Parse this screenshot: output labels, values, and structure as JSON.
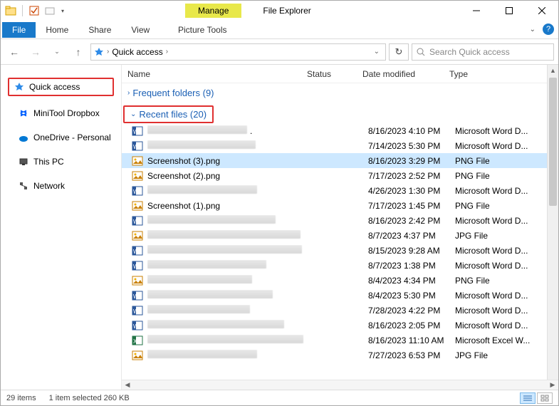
{
  "titlebar": {
    "manage_label": "Manage",
    "app_title": "File Explorer"
  },
  "ribbon": {
    "file": "File",
    "home": "Home",
    "share": "Share",
    "view": "View",
    "picture_tools": "Picture Tools"
  },
  "nav": {
    "crumb_root": "Quick access",
    "search_placeholder": "Search Quick access"
  },
  "sidebar": {
    "quick_access": "Quick access",
    "dropbox": "MiniTool Dropbox",
    "onedrive": "OneDrive - Personal",
    "this_pc": "This PC",
    "network": "Network"
  },
  "columns": {
    "name": "Name",
    "status": "Status",
    "date": "Date modified",
    "type": "Type"
  },
  "groups": {
    "frequent": {
      "label": "Frequent folders",
      "count": 9
    },
    "recent": {
      "label": "Recent files",
      "count": 20
    }
  },
  "files": [
    {
      "name": "",
      "blurred": true,
      "date": "8/16/2023 4:10 PM",
      "type": "Microsoft Word D...",
      "icon": "word",
      "selected": false,
      "dotafter": true
    },
    {
      "name": "",
      "blurred": true,
      "date": "7/14/2023 5:30 PM",
      "type": "Microsoft Word D...",
      "icon": "word",
      "selected": false
    },
    {
      "name": "Screenshot (3).png",
      "blurred": false,
      "date": "8/16/2023 3:29 PM",
      "type": "PNG File",
      "icon": "png",
      "selected": true
    },
    {
      "name": "Screenshot (2).png",
      "blurred": false,
      "date": "7/17/2023 2:52 PM",
      "type": "PNG File",
      "icon": "png",
      "selected": false
    },
    {
      "name": "",
      "blurred": true,
      "date": "4/26/2023 1:30 PM",
      "type": "Microsoft Word D...",
      "icon": "word",
      "selected": false
    },
    {
      "name": "Screenshot (1).png",
      "blurred": false,
      "date": "7/17/2023 1:45 PM",
      "type": "PNG File",
      "icon": "png",
      "selected": false
    },
    {
      "name": "",
      "blurred": true,
      "date": "8/16/2023 2:42 PM",
      "type": "Microsoft Word D...",
      "icon": "word",
      "selected": false
    },
    {
      "name": "",
      "blurred": true,
      "date": "8/7/2023 4:37 PM",
      "type": "JPG File",
      "icon": "jpg",
      "selected": false
    },
    {
      "name": "",
      "blurred": true,
      "date": "8/15/2023 9:28 AM",
      "type": "Microsoft Word D...",
      "icon": "word",
      "selected": false
    },
    {
      "name": "",
      "blurred": true,
      "date": "8/7/2023 1:38 PM",
      "type": "Microsoft Word D...",
      "icon": "word",
      "selected": false
    },
    {
      "name": "",
      "blurred": true,
      "date": "8/4/2023 4:34 PM",
      "type": "PNG File",
      "icon": "png",
      "selected": false
    },
    {
      "name": "",
      "blurred": true,
      "date": "8/4/2023 5:30 PM",
      "type": "Microsoft Word D...",
      "icon": "word",
      "selected": false
    },
    {
      "name": "",
      "blurred": true,
      "date": "7/28/2023 4:22 PM",
      "type": "Microsoft Word D...",
      "icon": "word",
      "selected": false
    },
    {
      "name": "",
      "blurred": true,
      "date": "8/16/2023 2:05 PM",
      "type": "Microsoft Word D...",
      "icon": "word",
      "selected": false
    },
    {
      "name": "",
      "blurred": true,
      "date": "8/16/2023 11:10 AM",
      "type": "Microsoft Excel W...",
      "icon": "excel",
      "selected": false
    },
    {
      "name": "",
      "blurred": true,
      "date": "7/27/2023 6:53 PM",
      "type": "JPG File",
      "icon": "jpg",
      "selected": false
    }
  ],
  "status": {
    "item_count": "29 items",
    "selection": "1 item selected",
    "size": "260 KB"
  }
}
